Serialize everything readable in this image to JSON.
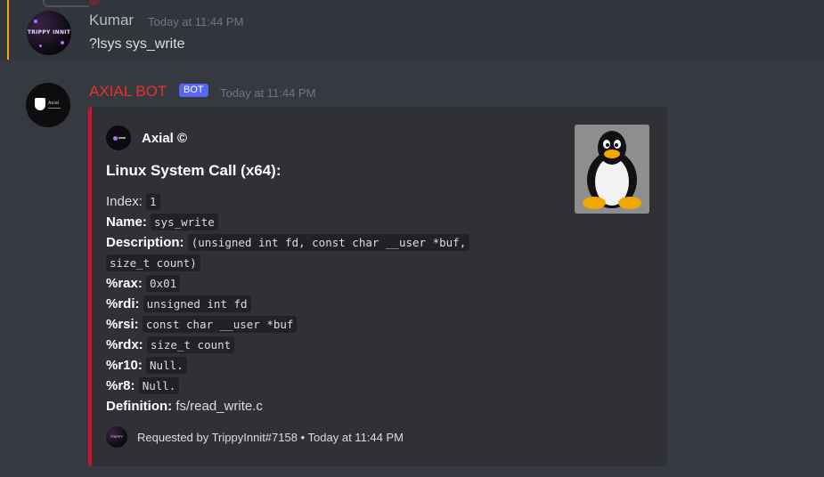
{
  "messages": {
    "kumar": {
      "username": "Kumar",
      "timestamp": "Today at 11:44 PM",
      "content": "?lsys sys_write",
      "avatar_text": "TRIPPY INNIT"
    },
    "axial": {
      "username": "AXIAL BOT",
      "bot_tag": "BOT",
      "timestamp": "Today at 11:44 PM",
      "avatar_text": "Axial"
    }
  },
  "embed": {
    "accent_color": "#d2112f",
    "author": "Axial ©",
    "title": "Linux System Call (x64):",
    "thumbnail": "tux-penguin",
    "fields": {
      "index_label": "Index:",
      "index_value": "1",
      "name_label": "Name:",
      "name_value": "sys_write",
      "description_label": "Description:",
      "description_value_1": "(unsigned int fd, const char __user *buf,",
      "description_value_2": "size_t count)",
      "rax_label": "%rax:",
      "rax_value": "0x01",
      "rdi_label": "%rdi:",
      "rdi_value": "unsigned int fd",
      "rsi_label": "%rsi:",
      "rsi_value": "const char __user *buf",
      "rdx_label": "%rdx:",
      "rdx_value": "size_t count",
      "r10_label": "%r10:",
      "r10_value": "Null.",
      "r8_label": "%r8:",
      "r8_value": "Null.",
      "definition_label": "Definition:",
      "definition_value": "fs/read_write.c"
    },
    "footer": {
      "requested_by": "Requested by TrippyInnit#7158",
      "separator": "•",
      "timestamp": "Today at 11:44 PM"
    }
  },
  "colors": {
    "background": "#36393f",
    "embed_bg": "#2f3136",
    "bot_name": "#e9302c",
    "bot_tag": "#5865f2",
    "mention_bar": "#faa61a"
  }
}
